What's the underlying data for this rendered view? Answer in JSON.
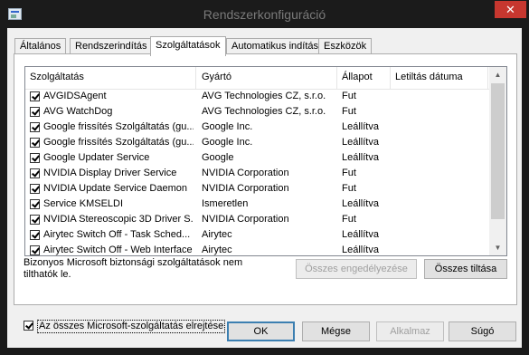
{
  "window": {
    "title": "Rendszerkonfiguráció",
    "close_label": "✕"
  },
  "tabs": [
    {
      "label": "Általános"
    },
    {
      "label": "Rendszerindítás"
    },
    {
      "label": "Szolgáltatások",
      "active": true
    },
    {
      "label": "Automatikus indítás"
    },
    {
      "label": "Eszközök"
    }
  ],
  "list": {
    "columns": [
      "Szolgáltatás",
      "Gyártó",
      "Állapot",
      "Letiltás dátuma"
    ],
    "rows": [
      {
        "name": "AVGIDSAgent",
        "vendor": "AVG Technologies CZ, s.r.o.",
        "status": "Fut",
        "disabled_date": "",
        "checked": true
      },
      {
        "name": "AVG WatchDog",
        "vendor": "AVG Technologies CZ, s.r.o.",
        "status": "Fut",
        "disabled_date": "",
        "checked": true
      },
      {
        "name": "Google frissítés Szolgáltatás (gu...",
        "vendor": "Google Inc.",
        "status": "Leállítva",
        "disabled_date": "",
        "checked": true
      },
      {
        "name": "Google frissítés Szolgáltatás (gu...",
        "vendor": "Google Inc.",
        "status": "Leállítva",
        "disabled_date": "",
        "checked": true
      },
      {
        "name": "Google Updater Service",
        "vendor": "Google",
        "status": "Leállítva",
        "disabled_date": "",
        "checked": true
      },
      {
        "name": "NVIDIA Display Driver Service",
        "vendor": "NVIDIA Corporation",
        "status": "Fut",
        "disabled_date": "",
        "checked": true
      },
      {
        "name": "NVIDIA Update Service Daemon",
        "vendor": "NVIDIA Corporation",
        "status": "Fut",
        "disabled_date": "",
        "checked": true
      },
      {
        "name": "Service KMSELDI",
        "vendor": "Ismeretlen",
        "status": "Leállítva",
        "disabled_date": "",
        "checked": true
      },
      {
        "name": "NVIDIA Stereoscopic 3D Driver S...",
        "vendor": "NVIDIA Corporation",
        "status": "Fut",
        "disabled_date": "",
        "checked": true
      },
      {
        "name": "Airytec Switch Off - Task Sched...",
        "vendor": "Airytec",
        "status": "Leállítva",
        "disabled_date": "",
        "checked": true
      },
      {
        "name": "Airytec Switch Off - Web Interface",
        "vendor": "Airytec",
        "status": "Leállítva",
        "disabled_date": "",
        "checked": true
      }
    ]
  },
  "note": "Bizonyos Microsoft biztonsági szolgáltatások nem tilthatók le.",
  "buttons": {
    "enable_all": "Összes engedélyezése",
    "disable_all": "Összes tiltása",
    "ok": "OK",
    "cancel": "Mégse",
    "apply": "Alkalmaz",
    "help": "Súgó"
  },
  "hide_ms": {
    "label": "Az összes Microsoft-szolgáltatás elrejtése",
    "checked": true
  }
}
